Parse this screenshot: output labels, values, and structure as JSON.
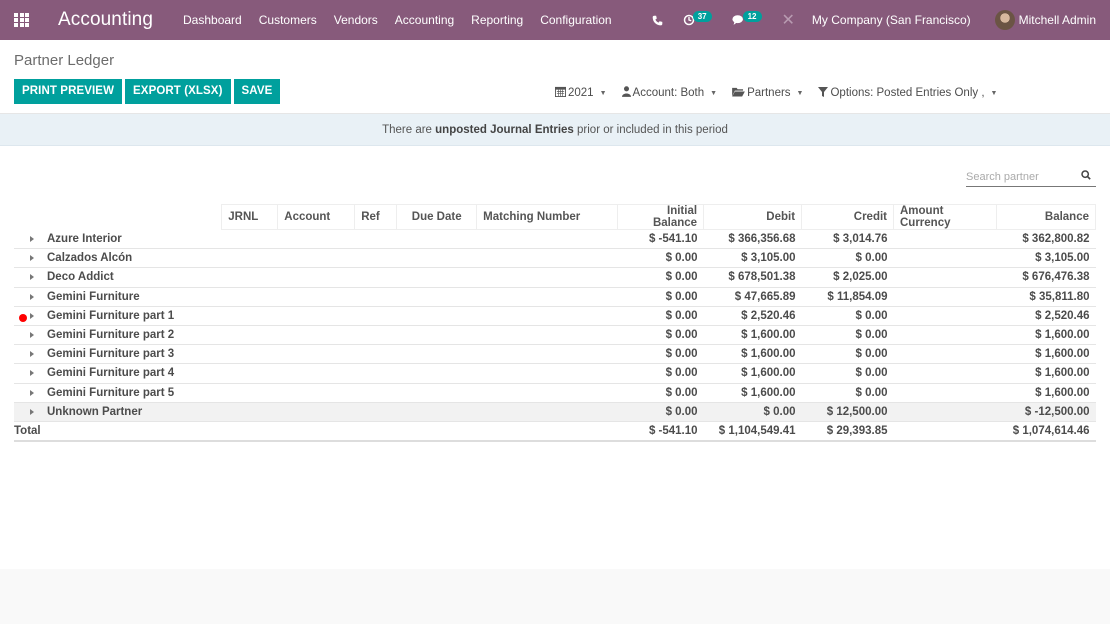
{
  "navbar": {
    "brand": "Accounting",
    "menu": [
      "Dashboard",
      "Customers",
      "Vendors",
      "Accounting",
      "Reporting",
      "Configuration"
    ],
    "phone_icon": "phone-icon",
    "activity_badge": "37",
    "messages_badge": "12",
    "company": "My Company (San Francisco)",
    "user": "Mitchell Admin"
  },
  "page": {
    "title": "Partner Ledger",
    "buttons": {
      "print": "PRINT PREVIEW",
      "export": "EXPORT (XLSX)",
      "save": "SAVE"
    },
    "filters": {
      "date": "2021",
      "account": "Account: Both",
      "partners": "Partners",
      "options": "Options: Posted Entries Only ,"
    },
    "warning": {
      "pre": "There are ",
      "bold": "unposted Journal Entries",
      "post": " prior or included in this period"
    },
    "search_placeholder": "Search partner"
  },
  "table": {
    "headers": [
      "JRNL",
      "Account",
      "Ref",
      "Due Date",
      "Matching Number",
      "Initial Balance",
      "Debit",
      "Credit",
      "Amount Currency",
      "Balance"
    ],
    "rows": [
      {
        "name": "Azure Interior",
        "initial": "$ -541.10",
        "debit": "$ 366,356.68",
        "credit": "$ 3,014.76",
        "currency": "",
        "balance": "$ 362,800.82"
      },
      {
        "name": "Calzados Alcón",
        "initial": "$ 0.00",
        "debit": "$ 3,105.00",
        "credit": "$ 0.00",
        "currency": "",
        "balance": "$ 3,105.00"
      },
      {
        "name": "Deco Addict",
        "initial": "$ 0.00",
        "debit": "$ 678,501.38",
        "credit": "$ 2,025.00",
        "currency": "",
        "balance": "$ 676,476.38"
      },
      {
        "name": "Gemini Furniture",
        "initial": "$ 0.00",
        "debit": "$ 47,665.89",
        "credit": "$ 11,854.09",
        "currency": "",
        "balance": "$ 35,811.80"
      },
      {
        "name": "Gemini Furniture part 1",
        "initial": "$ 0.00",
        "debit": "$ 2,520.46",
        "credit": "$ 0.00",
        "currency": "",
        "balance": "$ 2,520.46"
      },
      {
        "name": "Gemini Furniture part 2",
        "initial": "$ 0.00",
        "debit": "$ 1,600.00",
        "credit": "$ 0.00",
        "currency": "",
        "balance": "$ 1,600.00"
      },
      {
        "name": "Gemini Furniture part 3",
        "initial": "$ 0.00",
        "debit": "$ 1,600.00",
        "credit": "$ 0.00",
        "currency": "",
        "balance": "$ 1,600.00"
      },
      {
        "name": "Gemini Furniture part 4",
        "initial": "$ 0.00",
        "debit": "$ 1,600.00",
        "credit": "$ 0.00",
        "currency": "",
        "balance": "$ 1,600.00"
      },
      {
        "name": "Gemini Furniture part 5",
        "initial": "$ 0.00",
        "debit": "$ 1,600.00",
        "credit": "$ 0.00",
        "currency": "",
        "balance": "$ 1,600.00"
      },
      {
        "name": "Unknown Partner",
        "initial": "$ 0.00",
        "debit": "$ 0.00",
        "credit": "$ 12,500.00",
        "currency": "",
        "balance": "$ -12,500.00"
      }
    ],
    "total": {
      "name": "Total",
      "initial": "$ -541.10",
      "debit": "$ 1,104,549.41",
      "credit": "$ 29,393.85",
      "currency": "",
      "balance": "$ 1,074,614.46"
    }
  }
}
